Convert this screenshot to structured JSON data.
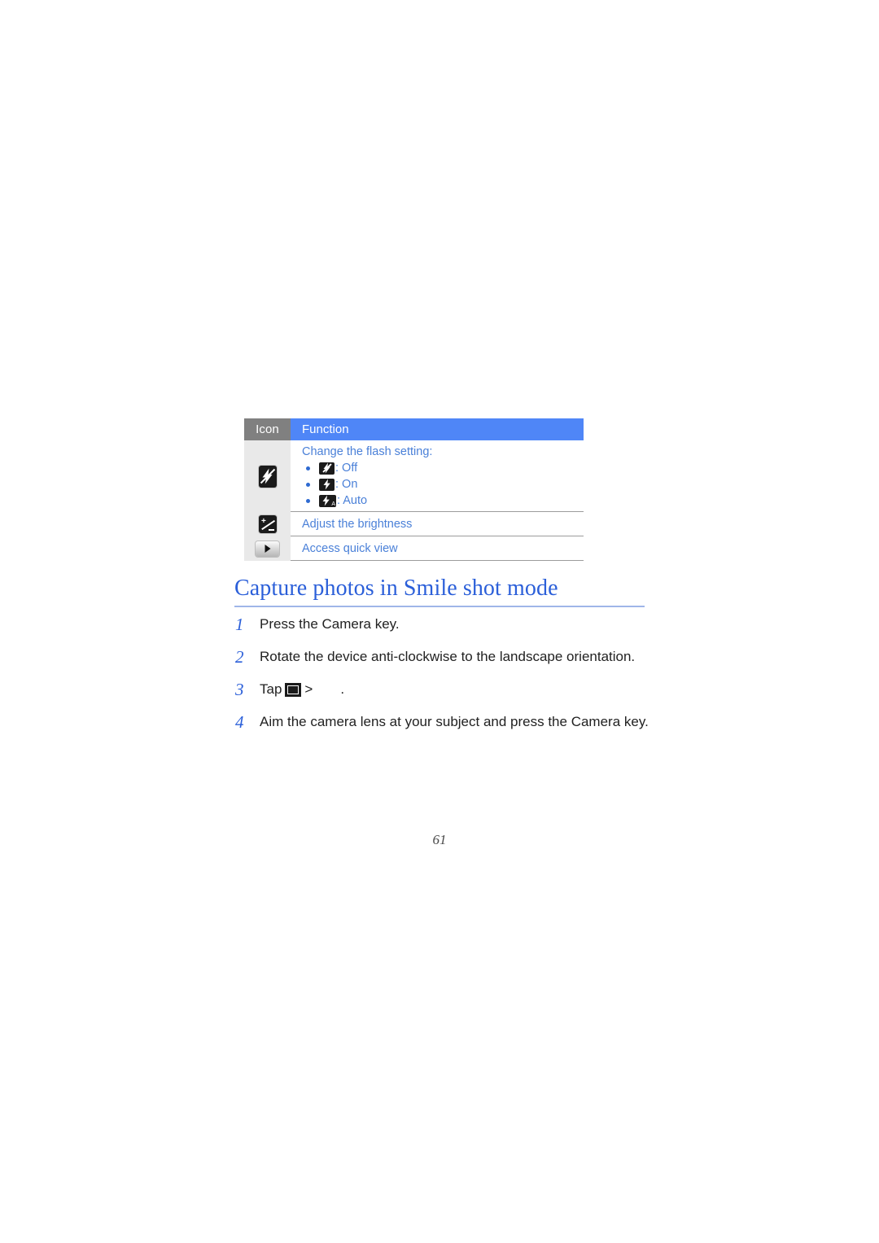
{
  "document": {
    "page_number": "61"
  },
  "icon_table": {
    "headers": {
      "icon": "Icon",
      "function": "Function"
    },
    "rows": [
      {
        "icon": "flash-off-icon",
        "function_title": "Change the flash setting:",
        "options": [
          {
            "icon": "flash-off-icon",
            "label": ": Off"
          },
          {
            "icon": "flash-on-icon",
            "label": ": On"
          },
          {
            "icon": "flash-auto-icon",
            "label": ": Auto"
          }
        ]
      },
      {
        "icon": "brightness-icon",
        "function_title": "Adjust the brightness",
        "options": []
      },
      {
        "icon": "quick-view-icon",
        "function_title": "Access quick view",
        "options": []
      }
    ]
  },
  "section": {
    "heading": "Capture photos in Smile shot mode",
    "steps": [
      {
        "number": "1",
        "text": "Press the Camera key."
      },
      {
        "number": "2",
        "text": "Rotate the device anti-clockwise to the landscape orientation."
      },
      {
        "number": "3",
        "prefix": "Tap",
        "icon": "shooting-mode-icon",
        "separator": ">",
        "suffix": "."
      },
      {
        "number": "4",
        "text": "Aim the camera lens at your subject and press the Camera key."
      }
    ]
  },
  "colors": {
    "header_blue": "#4f86f7",
    "header_gray": "#808080",
    "body_text_blue": "#4a80d8",
    "heading_blue": "#2b5fd9",
    "icon_cell_gray": "#e9e9e9",
    "row_rule_gray": "#9c9c9c",
    "heading_rule": "#9fb6e8"
  }
}
